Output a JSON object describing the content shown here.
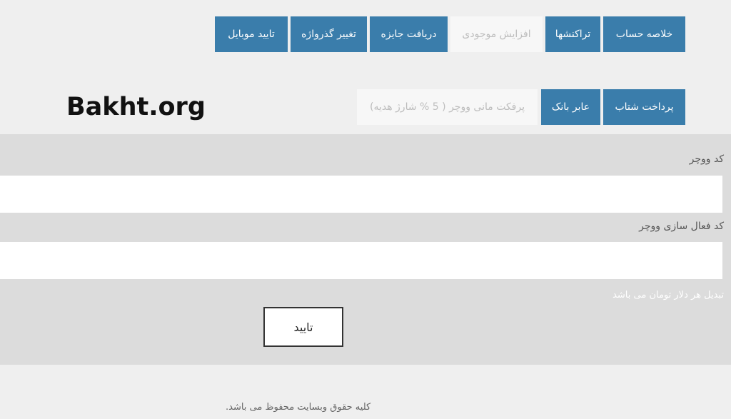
{
  "top_nav": {
    "tabs": [
      {
        "label": "خلاصه حساب",
        "active": true
      },
      {
        "label": "تراکنشها",
        "active": true
      },
      {
        "label": "افزایش موجودی",
        "active": false
      },
      {
        "label": "دریافت جایزه",
        "active": true
      },
      {
        "label": "تغییر گذرواژه",
        "active": true
      },
      {
        "label": "تایید موبایل",
        "active": true
      }
    ]
  },
  "sub_nav": {
    "tabs": [
      {
        "label": "پرداخت شتاب",
        "active": true
      },
      {
        "label": "عابر بانک",
        "active": true
      },
      {
        "label": "پرفکت مانی ووچر ( 5 % شارژ هدیه)",
        "active": false
      }
    ]
  },
  "logo": {
    "text": "Bakht.org"
  },
  "form": {
    "voucher_code_label": "کد ووچر",
    "voucher_code_value": "",
    "activation_code_label": "کد فعال سازی ووچر",
    "activation_code_value": "",
    "note": "تبدیل هر دلار تومان می باشد",
    "submit_label": "تایید"
  },
  "footer": {
    "copyright": "کلیه حقوق وبسایت محفوظ می باشد."
  },
  "colors": {
    "accent": "#3a7dab",
    "panel": "#dcdcdc",
    "background": "#efefef"
  }
}
